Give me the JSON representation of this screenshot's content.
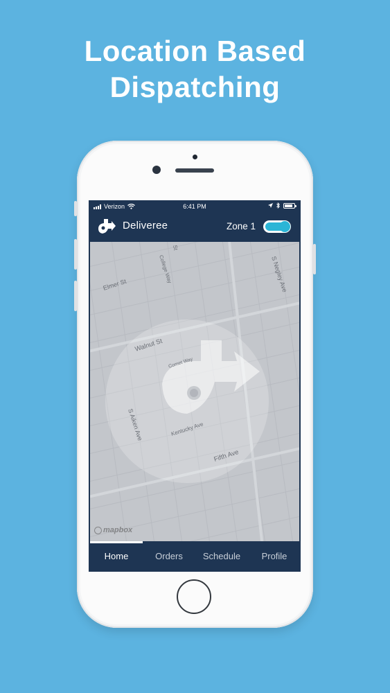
{
  "headline": {
    "line1": "Location Based",
    "line2": "Dispatching"
  },
  "status_bar": {
    "carrier": "Verizon",
    "time": "6:41 PM"
  },
  "app_bar": {
    "app_name": "Deliveree",
    "zone_label": "Zone 1",
    "zone_toggle_on": true,
    "logo_icon": "deliveree-logo-icon"
  },
  "map": {
    "streets": {
      "elmer": "Elmer St",
      "college": "College Way",
      "negley": "S Negley Ave",
      "walnut": "Walnut St",
      "comet": "Comet Way",
      "aiken": "S Aiken Ave",
      "kentucky": "Kentucky Ave",
      "fifth": "Fifth Ave",
      "st_fragment": "St"
    },
    "attribution": "mapbox"
  },
  "tab_bar": {
    "tabs": [
      {
        "label": "Home",
        "active": true
      },
      {
        "label": "Orders",
        "active": false
      },
      {
        "label": "Schedule",
        "active": false
      },
      {
        "label": "Profile",
        "active": false
      }
    ]
  },
  "colors": {
    "background": "#5cb3e0",
    "app_bar": "#1e3553",
    "toggle_accent": "#2bb5d6",
    "map_base": "#c3c6cb"
  }
}
